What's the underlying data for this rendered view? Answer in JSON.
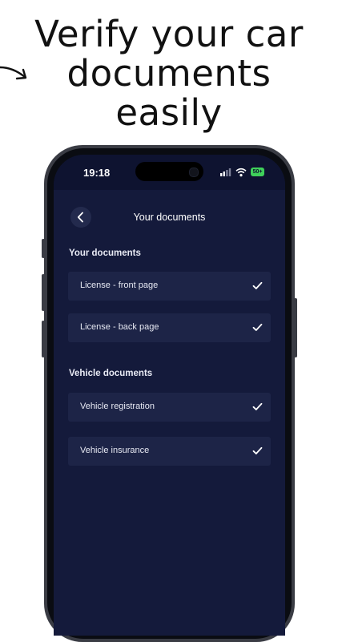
{
  "headline": {
    "lines": [
      "Verify your car",
      "documents",
      "easily"
    ]
  },
  "status_bar": {
    "time": "19:18",
    "battery": "50+",
    "icons": [
      "signal-icon",
      "wifi-icon",
      "battery-icon"
    ]
  },
  "nav": {
    "title": "Your documents",
    "back_icon": "chevron-left-icon"
  },
  "sections": [
    {
      "title": "Your documents",
      "items": [
        {
          "label": "License - front page",
          "checked": true
        },
        {
          "label": "License - back page",
          "checked": true
        }
      ]
    },
    {
      "title": "Vehicle documents",
      "items": [
        {
          "label": "Vehicle registration",
          "checked": true
        },
        {
          "label": "Vehicle insurance",
          "checked": true
        }
      ]
    }
  ],
  "colors": {
    "screen_bg": "#141a3b",
    "row_bg": "#1d2447",
    "text": "#ffffff",
    "battery": "#3fd15a"
  }
}
